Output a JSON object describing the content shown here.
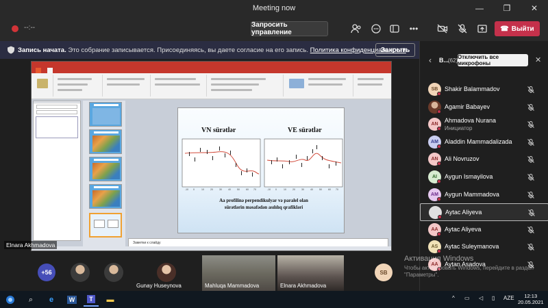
{
  "window": {
    "title": "Meeting now"
  },
  "toolbar": {
    "timer": "--:--",
    "request_control": "Запросить управление",
    "leave": "Выйти"
  },
  "banner": {
    "bold": "Запись начата.",
    "text": " Это собрание записывается. Присоединяясь, вы даете согласие на его запись. ",
    "link": "Политика конфиденциальности",
    "close": "Закрыть"
  },
  "shared": {
    "presenter": "Elnara Akhmadova",
    "slide_title_left": "VN sürətlər",
    "slide_title_right": "VE sürətlər",
    "caption_line1": "Aa profilinə perpendikulyar  və paralel olan",
    "caption_line2": "sürətlərin  məsafədən asılılıq  qrafikləri",
    "notes": "Заметки к слайду",
    "chart_x_ticks": [
      "-10",
      "0",
      "10",
      "20",
      "30",
      "40",
      "50",
      "60",
      "70"
    ]
  },
  "panel": {
    "title": "В...",
    "count": "(62)",
    "mute_all": "Отключить все микрофоны",
    "participants": [
      {
        "initials": "SB",
        "name": "Shakir Balammadov",
        "role": "",
        "color": "#f1d5b8",
        "fg": "#6b4a2a",
        "photo": false
      },
      {
        "initials": "",
        "name": "Agamir Babayev",
        "role": "",
        "color": "#7a4a38",
        "fg": "#fff",
        "photo": true
      },
      {
        "initials": "AN",
        "name": "Ahmadova Nurana",
        "role": "Инициатор",
        "color": "#f4c7c7",
        "fg": "#8a2a2a",
        "photo": false
      },
      {
        "initials": "AM",
        "name": "Aladdin Mammadalizada",
        "role": "",
        "color": "#c9cdf0",
        "fg": "#333a8a",
        "photo": false
      },
      {
        "initials": "AN",
        "name": "Ali Novruzov",
        "role": "",
        "color": "#f4c7c7",
        "fg": "#8a2a2a",
        "photo": false
      },
      {
        "initials": "AI",
        "name": "Aygun Ismayilova",
        "role": "",
        "color": "#d7ecd1",
        "fg": "#2e6a2a",
        "photo": false
      },
      {
        "initials": "AM",
        "name": "Aygun Mammadova",
        "role": "",
        "color": "#e6c9f0",
        "fg": "#6a2a8a",
        "photo": false
      },
      {
        "initials": "",
        "name": "Aytac Aliyeva",
        "role": "",
        "color": "#e0e0e0",
        "fg": "#555",
        "photo": false
      },
      {
        "initials": "AA",
        "name": "Aytac Aliyeva",
        "role": "",
        "color": "#f4c7c7",
        "fg": "#8a2a2a",
        "photo": false
      },
      {
        "initials": "AS",
        "name": "Aytac Suleymanova",
        "role": "",
        "color": "#f1e2b8",
        "fg": "#6b5a2a",
        "photo": false
      },
      {
        "initials": "AA",
        "name": "Aytan Asadova",
        "role": "",
        "color": "#f4c7c7",
        "fg": "#8a2a2a",
        "photo": false
      }
    ]
  },
  "tiles": {
    "more_count": "+56",
    "gunay": "Gunay Huseynova",
    "mahluqa": "Mahluqa Mammadova",
    "elnara": "Elnara Akhmadova",
    "sb": "SB"
  },
  "watermark": {
    "line1": "Активация Windows",
    "line2": "Чтобы активировать Windows, перейдите в раздел \"Параметры\"."
  },
  "taskbar": {
    "lang": "AZE",
    "time": "12:13",
    "date": "20.05.2021"
  }
}
